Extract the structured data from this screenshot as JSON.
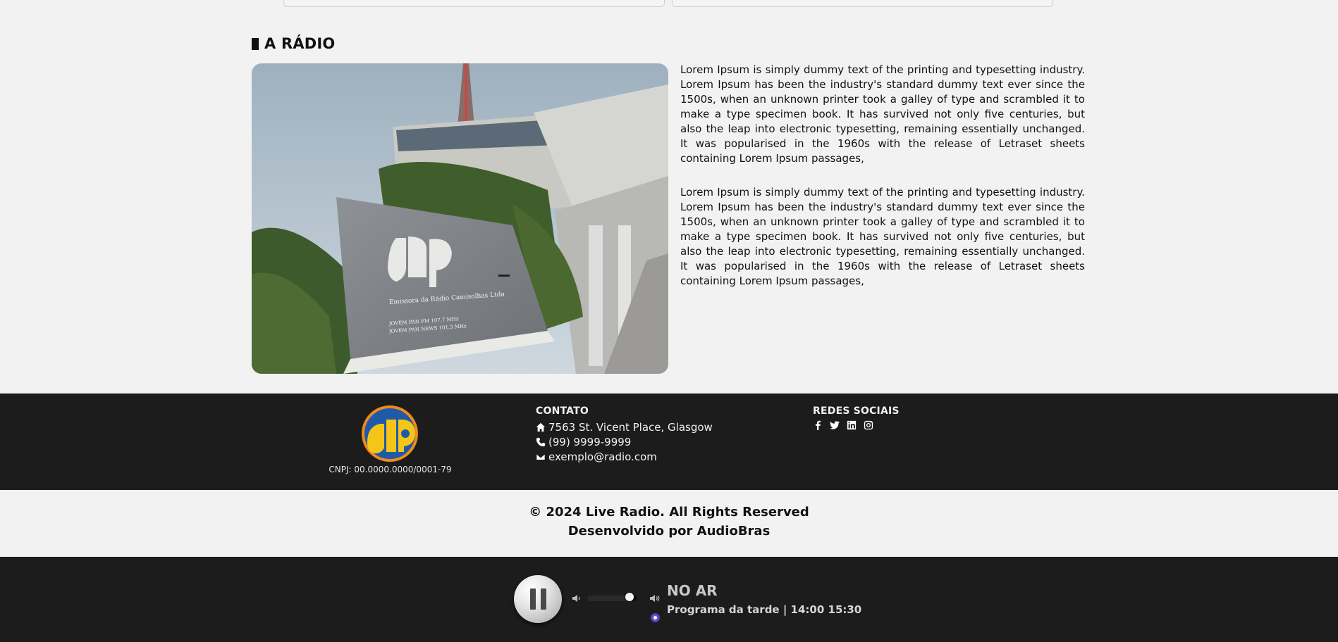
{
  "section": {
    "title": "A RÁDIO"
  },
  "photo": {
    "alt": "Emissora da Rádio Camisolhas Ltda",
    "sign_lines": [
      "Emissora da Rádio Camisolhas Ltda",
      "JOVEM PAN FM 107,7 MHz",
      "JOVEM PAN NEWS 101,3 MHz"
    ]
  },
  "about": {
    "paragraphs": [
      "Lorem Ipsum is simply dummy text of the printing and typesetting industry. Lorem Ipsum has been the industry's standard dummy text ever since the 1500s, when an unknown printer took a galley of type and scrambled it to make a type specimen book. It has survived not only five centuries, but also the leap into electronic typesetting, remaining essentially unchanged. It was popularised in the 1960s with the release of Letraset sheets containing Lorem Ipsum passages,",
      "Lorem Ipsum is simply dummy text of the printing and typesetting industry. Lorem Ipsum has been the industry's standard dummy text ever since the 1500s, when an unknown printer took a galley of type and scrambled it to make a type specimen book. It has survived not only five centuries, but also the leap into electronic typesetting, remaining essentially unchanged. It was popularised in the 1960s with the release of Letraset sheets containing Lorem Ipsum passages,"
    ]
  },
  "footer": {
    "logo_icon": "jovem-pan-logo",
    "cnpj": "CNPJ: 00.0000.0000/0001-79",
    "contact": {
      "heading": "CONTATO",
      "address": "7563 St. Vicent Place, Glasgow",
      "phone": "(99) 9999-9999",
      "email": "exemplo@radio.com"
    },
    "social": {
      "heading": "REDES SOCIAIS",
      "icons": [
        "facebook-icon",
        "twitter-icon",
        "linkedin-icon",
        "instagram-icon"
      ]
    }
  },
  "copyright": {
    "line1": "© 2024 Live Radio. All Rights Reserved",
    "line2": "Desenvolvido por AudioBras"
  },
  "player": {
    "state": "playing",
    "volume": 0.85,
    "status_label": "NO AR",
    "program": "Programa da tarde | 14:00 15:30"
  },
  "colors": {
    "background": "#f2f2f2",
    "footer_bg": "#1c1c1c",
    "logo_blue": "#1e5aa8",
    "logo_yellow": "#f5c518",
    "logo_orange": "#f08a1c",
    "live_dot": "#6b4fd6"
  }
}
